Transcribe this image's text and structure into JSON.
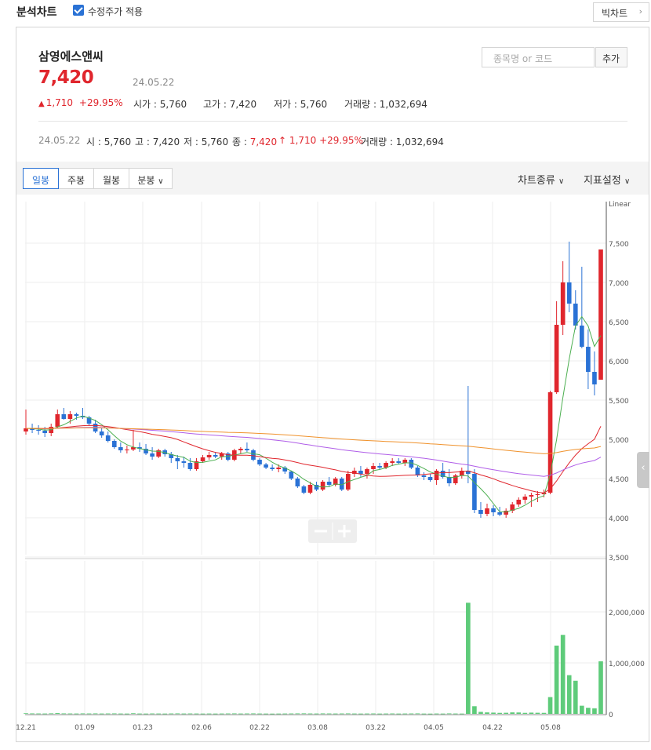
{
  "header": {
    "title": "분석차트",
    "adjusted_price_label": "수정주가 적용",
    "adjusted_price_checked": true,
    "big_chart_button": "빅차트"
  },
  "stock": {
    "name": "삼영에스앤씨",
    "price": "7,420",
    "date": "24.05.22",
    "change": "1,710",
    "change_pct": "+29.95%",
    "open_label": "시가",
    "open": "5,760",
    "high_label": "고가",
    "high": "7,420",
    "low_label": "저가",
    "low": "5,760",
    "volume_label": "거래량",
    "volume": "1,032,694"
  },
  "search": {
    "placeholder": "종목명 or 코드",
    "add_button": "추가"
  },
  "info_line": {
    "date": "24.05.22",
    "open_label": "시",
    "open": "5,760",
    "high_label": "고",
    "high": "7,420",
    "low_label": "저",
    "low": "5,760",
    "close_label": "종",
    "close": "7,420",
    "change": "1,710",
    "change_pct": "+29.95%",
    "volume_label": "거래량",
    "volume": "1,032,694"
  },
  "tabs": [
    "일봉",
    "주봉",
    "월봉",
    "분봉"
  ],
  "active_tab": "일봉",
  "right_menu": {
    "chart_type": "차트종류",
    "indicator_settings": "지표설정"
  },
  "colors": {
    "up": "#e0262d",
    "down": "#2a72d5",
    "ma5": "#4caf50",
    "ma20": "#e0262d",
    "ma60": "#b05ee8",
    "ma120": "#f0922c",
    "volume": "#5ecb7a"
  },
  "chart_data": {
    "type": "candlestick",
    "scale_label": "Linear",
    "price_axis": {
      "min": 3500,
      "max": 7500,
      "ticks": [
        "7,500",
        "7,000",
        "6,500",
        "6,000",
        "5,500",
        "5,000",
        "4,500",
        "4,000",
        "3,500"
      ]
    },
    "volume_axis": {
      "min": 0,
      "max": 2000000,
      "ticks": [
        "2,000,000",
        "1,000,000",
        "0"
      ]
    },
    "x_tick_labels": [
      "12.21",
      "01.09",
      "01.23",
      "02.06",
      "02.22",
      "03.08",
      "03.22",
      "04.05",
      "04.22",
      "05.08"
    ],
    "candles": [
      [
        5100,
        5380,
        5060,
        5140
      ],
      [
        5140,
        5200,
        5080,
        5120
      ],
      [
        5120,
        5180,
        5060,
        5110
      ],
      [
        5110,
        5160,
        5030,
        5080
      ],
      [
        5080,
        5200,
        5040,
        5160
      ],
      [
        5160,
        5380,
        5140,
        5320
      ],
      [
        5320,
        5400,
        5250,
        5260
      ],
      [
        5260,
        5360,
        5200,
        5320
      ],
      [
        5320,
        5340,
        5250,
        5300
      ],
      [
        5300,
        5400,
        5260,
        5280
      ],
      [
        5280,
        5300,
        5180,
        5200
      ],
      [
        5200,
        5250,
        5080,
        5100
      ],
      [
        5100,
        5150,
        5020,
        5050
      ],
      [
        5050,
        5100,
        4960,
        4980
      ],
      [
        4980,
        5000,
        4880,
        4900
      ],
      [
        4900,
        4960,
        4830,
        4860
      ],
      [
        4860,
        4920,
        4820,
        4870
      ],
      [
        4870,
        5120,
        4850,
        4900
      ],
      [
        4900,
        4960,
        4840,
        4880
      ],
      [
        4880,
        4940,
        4800,
        4820
      ],
      [
        4820,
        4900,
        4740,
        4780
      ],
      [
        4780,
        4880,
        4760,
        4860
      ],
      [
        4860,
        4880,
        4780,
        4810
      ],
      [
        4810,
        4840,
        4700,
        4760
      ],
      [
        4760,
        4800,
        4620,
        4720
      ],
      [
        4720,
        4780,
        4640,
        4700
      ],
      [
        4700,
        4760,
        4600,
        4620
      ],
      [
        4620,
        4760,
        4600,
        4720
      ],
      [
        4720,
        4800,
        4700,
        4770
      ],
      [
        4770,
        4840,
        4740,
        4800
      ],
      [
        4800,
        4840,
        4760,
        4780
      ],
      [
        4780,
        4840,
        4740,
        4820
      ],
      [
        4820,
        4840,
        4720,
        4740
      ],
      [
        4740,
        4880,
        4720,
        4860
      ],
      [
        4860,
        4900,
        4820,
        4880
      ],
      [
        4880,
        4960,
        4840,
        4860
      ],
      [
        4860,
        4880,
        4720,
        4740
      ],
      [
        4740,
        4760,
        4660,
        4680
      ],
      [
        4680,
        4700,
        4620,
        4640
      ],
      [
        4640,
        4680,
        4600,
        4620
      ],
      [
        4620,
        4680,
        4580,
        4640
      ],
      [
        4640,
        4660,
        4560,
        4590
      ],
      [
        4590,
        4600,
        4480,
        4500
      ],
      [
        4500,
        4520,
        4380,
        4400
      ],
      [
        4400,
        4420,
        4300,
        4320
      ],
      [
        4320,
        4460,
        4300,
        4420
      ],
      [
        4420,
        4460,
        4340,
        4360
      ],
      [
        4360,
        4480,
        4340,
        4460
      ],
      [
        4460,
        4520,
        4400,
        4420
      ],
      [
        4420,
        4520,
        4400,
        4500
      ],
      [
        4500,
        4520,
        4340,
        4360
      ],
      [
        4360,
        4600,
        4340,
        4560
      ],
      [
        4560,
        4640,
        4520,
        4600
      ],
      [
        4600,
        4660,
        4520,
        4560
      ],
      [
        4560,
        4640,
        4500,
        4620
      ],
      [
        4620,
        4700,
        4560,
        4660
      ],
      [
        4660,
        4700,
        4620,
        4640
      ],
      [
        4640,
        4720,
        4620,
        4700
      ],
      [
        4700,
        4760,
        4660,
        4720
      ],
      [
        4720,
        4760,
        4680,
        4700
      ],
      [
        4700,
        4760,
        4660,
        4740
      ],
      [
        4740,
        4760,
        4620,
        4640
      ],
      [
        4640,
        4660,
        4520,
        4540
      ],
      [
        4540,
        4580,
        4480,
        4520
      ],
      [
        4520,
        4560,
        4460,
        4480
      ],
      [
        4480,
        4620,
        4420,
        4600
      ],
      [
        4600,
        4700,
        4500,
        4520
      ],
      [
        4520,
        4620,
        4400,
        4440
      ],
      [
        4440,
        4560,
        4420,
        4540
      ],
      [
        4540,
        4640,
        4500,
        4600
      ],
      [
        4600,
        5680,
        4440,
        4560
      ],
      [
        4560,
        4620,
        4060,
        4100
      ],
      [
        4100,
        4200,
        4000,
        4050
      ],
      [
        4050,
        4180,
        4020,
        4120
      ],
      [
        4120,
        4160,
        4020,
        4070
      ],
      [
        4070,
        4140,
        4020,
        4040
      ],
      [
        4040,
        4120,
        4000,
        4090
      ],
      [
        4090,
        4200,
        4060,
        4170
      ],
      [
        4170,
        4260,
        4140,
        4230
      ],
      [
        4230,
        4300,
        4180,
        4270
      ],
      [
        4270,
        4320,
        4140,
        4290
      ],
      [
        4290,
        4340,
        4200,
        4300
      ],
      [
        4300,
        4360,
        4260,
        4320
      ],
      [
        4320,
        5620,
        4300,
        5600
      ],
      [
        5600,
        6760,
        5580,
        6460
      ],
      [
        6460,
        7270,
        6330,
        7000
      ],
      [
        7000,
        7520,
        6620,
        6730
      ],
      [
        6730,
        6900,
        6400,
        6450
      ],
      [
        6450,
        7200,
        6160,
        6180
      ],
      [
        6180,
        6400,
        5640,
        5860
      ],
      [
        5860,
        6120,
        5560,
        5700
      ],
      [
        5760,
        7420,
        5760,
        7420
      ]
    ],
    "volumes": [
      12000,
      9000,
      8000,
      7000,
      10000,
      15000,
      9000,
      8000,
      7000,
      9000,
      8000,
      9000,
      7000,
      8000,
      9000,
      7000,
      6000,
      12000,
      7000,
      6000,
      8000,
      7000,
      6000,
      8000,
      9000,
      7000,
      8000,
      7000,
      6000,
      7000,
      6000,
      7000,
      8000,
      9000,
      7000,
      8000,
      9000,
      7000,
      6000,
      5000,
      6000,
      7000,
      8000,
      9000,
      10000,
      8000,
      7000,
      9000,
      8000,
      7000,
      8000,
      9000,
      7000,
      6000,
      7000,
      8000,
      6000,
      7000,
      8000,
      6000,
      7000,
      8000,
      9000,
      6000,
      5000,
      7000,
      6000,
      9000,
      7000,
      6000,
      2180000,
      150000,
      40000,
      30000,
      25000,
      20000,
      22000,
      30000,
      28000,
      20000,
      25000,
      22000,
      20000,
      330000,
      1340000,
      1550000,
      760000,
      650000,
      160000,
      120000,
      110000,
      1032694
    ],
    "moving_averages": [
      {
        "name": "5",
        "color": "#4caf50"
      },
      {
        "name": "20",
        "color": "#e0262d"
      },
      {
        "name": "60",
        "color": "#b05ee8"
      },
      {
        "name": "120",
        "color": "#f0922c"
      }
    ]
  }
}
